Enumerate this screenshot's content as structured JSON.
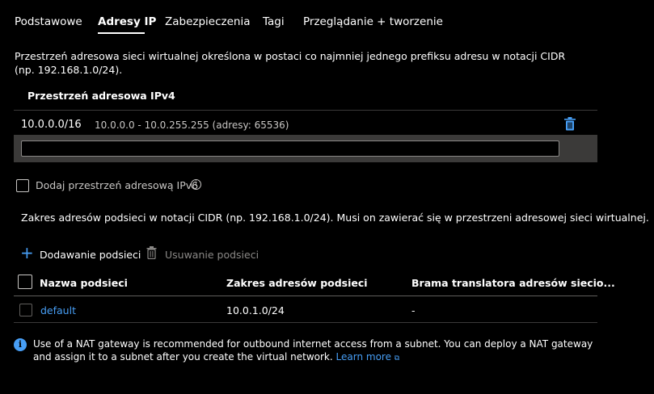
{
  "tabs": [
    "Podstawowe",
    "Adresy IP",
    "Zabezpieczenia",
    "Tagi",
    "Przeglądanie + tworzenie"
  ],
  "active_tab": "Adresy IP",
  "address_space_description": "Przestrzeń adresowa sieci wirtualnej określona w postaci co najmniej jednego prefiksu adresu w notacji CIDR (np. 192.168.1.0/24).",
  "ipv4": {
    "header": "Przestrzeń adresowa IPv4",
    "entry_cidr": "10.0.0.0/16",
    "entry_range": "10.0.0.0 - 10.0.255.255 (adresy: 65536)",
    "new_value": ""
  },
  "ipv6_checkbox_label": "Dodaj przestrzeń adresową IPv6",
  "ipv6_checked": false,
  "subnet_description": "Zakres adresów podsieci w notacji CIDR (np. 192.168.1.0/24). Musi on zawierać się w przestrzeni adresowej sieci wirtualnej.",
  "toolbar": {
    "add_label": "Dodawanie podsieci",
    "delete_label": "Usuwanie podsieci"
  },
  "subnet_table": {
    "headers": [
      "Nazwa podsieci",
      "Zakres adresów podsieci",
      "Brama translatora adresów siecio..."
    ],
    "rows": [
      {
        "name": "default",
        "range": "10.0.1.0/24",
        "nat": "-"
      }
    ]
  },
  "info_banner": {
    "text": "Use of a NAT gateway is recommended for outbound internet access from a subnet. You can deploy a NAT gateway and assign it to a subnet after you create the virtual network.",
    "link": "Learn more"
  },
  "colors": {
    "background": "#000000",
    "accent": "#479ef5",
    "band": "#3b3a39",
    "muted": "#8a8886"
  }
}
